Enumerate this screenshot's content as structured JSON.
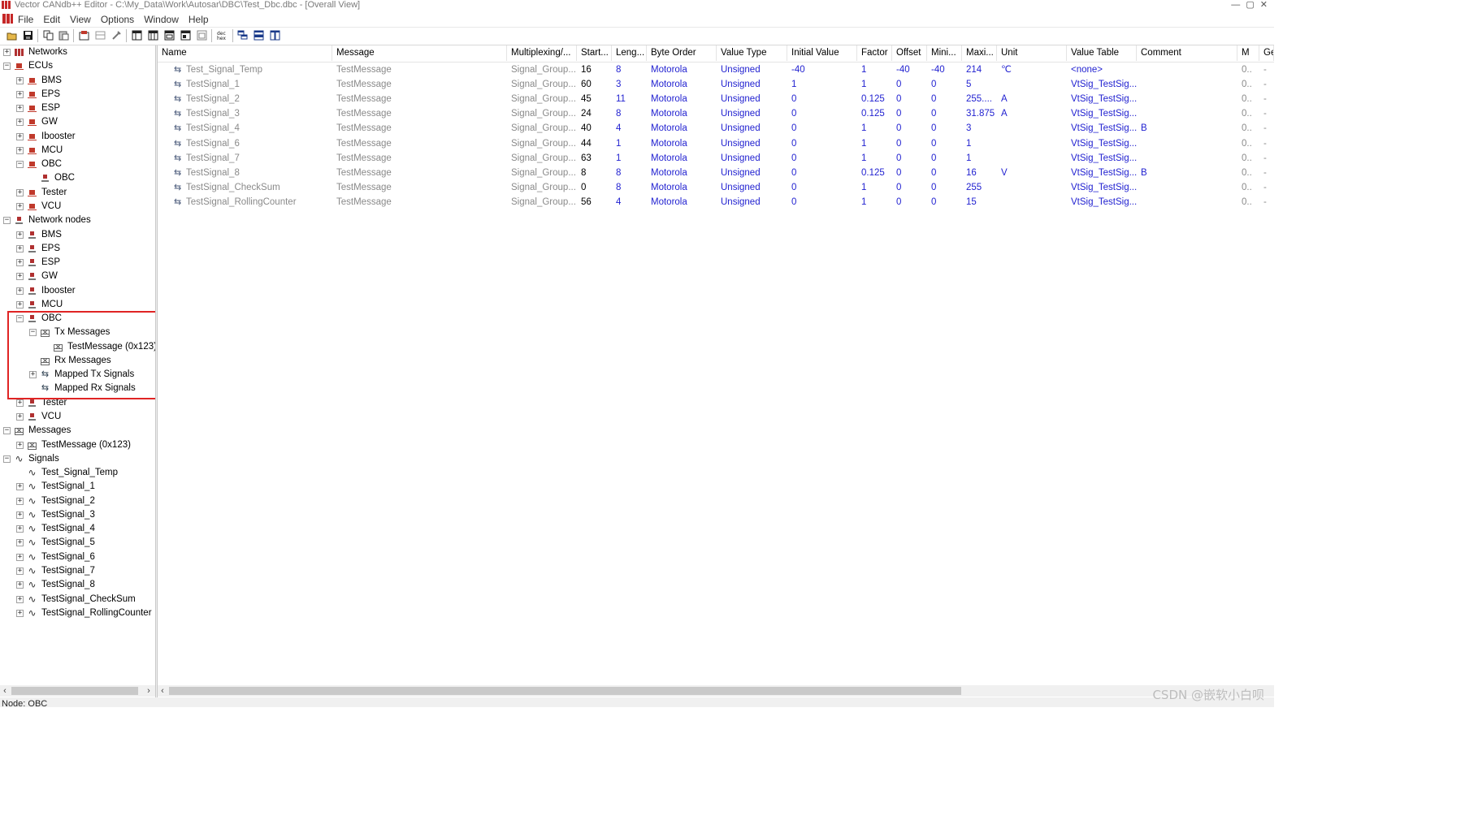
{
  "window": {
    "title": "Vector CANdb++ Editor - C:\\My_Data\\Work\\Autosar\\DBC\\Test_Dbc.dbc - [Overall View]",
    "controls": "— ▢ ✕"
  },
  "menu": [
    "File",
    "Edit",
    "View",
    "Options",
    "Window",
    "Help"
  ],
  "toolbar": {
    "buttons": [
      "open-icon",
      "save-icon",
      "copy-icon",
      "paste-icon",
      "properties-icon",
      "grid-icon",
      "tools-icon",
      "view1-icon",
      "view2-icon",
      "view3-icon",
      "view4-icon",
      "view5-icon",
      "dec-hex-icon",
      "cascade-icon",
      "tile-horizontal-icon",
      "tile-vertical-icon"
    ]
  },
  "tree": [
    {
      "label": "Networks",
      "exp": "+",
      "icon": "net"
    },
    {
      "label": "ECUs",
      "exp": "-",
      "icon": "ecu"
    },
    {
      "label": "BMS",
      "exp": "+",
      "icon": "ecu"
    },
    {
      "label": "EPS",
      "exp": "+",
      "icon": "ecu"
    },
    {
      "label": "ESP",
      "exp": "+",
      "icon": "ecu"
    },
    {
      "label": "GW",
      "exp": "+",
      "icon": "ecu"
    },
    {
      "label": "Ibooster",
      "exp": "+",
      "icon": "ecu"
    },
    {
      "label": "MCU",
      "exp": "+",
      "icon": "ecu"
    },
    {
      "label": "OBC",
      "exp": "-",
      "icon": "ecu"
    },
    {
      "label": "OBC",
      "exp": "",
      "icon": "node"
    },
    {
      "label": "Tester",
      "exp": "+",
      "icon": "ecu"
    },
    {
      "label": "VCU",
      "exp": "+",
      "icon": "ecu"
    },
    {
      "label": "Network nodes",
      "exp": "-",
      "icon": "node"
    },
    {
      "label": "BMS",
      "exp": "+",
      "icon": "node"
    },
    {
      "label": "EPS",
      "exp": "+",
      "icon": "node"
    },
    {
      "label": "ESP",
      "exp": "+",
      "icon": "node"
    },
    {
      "label": "GW",
      "exp": "+",
      "icon": "node"
    },
    {
      "label": "Ibooster",
      "exp": "+",
      "icon": "node"
    },
    {
      "label": "MCU",
      "exp": "+",
      "icon": "node"
    },
    {
      "label": "OBC",
      "exp": "-",
      "icon": "node"
    },
    {
      "label": "Tx Messages",
      "exp": "-",
      "icon": "msg"
    },
    {
      "label": "TestMessage (0x123)",
      "exp": "",
      "icon": "msg"
    },
    {
      "label": "Rx Messages",
      "exp": "",
      "icon": "msg"
    },
    {
      "label": "Mapped Tx Signals",
      "exp": "+",
      "icon": "map"
    },
    {
      "label": "Mapped Rx Signals",
      "exp": "",
      "icon": "map"
    },
    {
      "label": "Tester",
      "exp": "+",
      "icon": "node"
    },
    {
      "label": "VCU",
      "exp": "+",
      "icon": "node"
    },
    {
      "label": "Messages",
      "exp": "-",
      "icon": "msg"
    },
    {
      "label": "TestMessage (0x123)",
      "exp": "+",
      "icon": "msg"
    },
    {
      "label": "Signals",
      "exp": "-",
      "icon": "sig"
    },
    {
      "label": "Test_Signal_Temp",
      "exp": "",
      "icon": "sig"
    },
    {
      "label": "TestSignal_1",
      "exp": "+",
      "icon": "sig"
    },
    {
      "label": "TestSignal_2",
      "exp": "+",
      "icon": "sig"
    },
    {
      "label": "TestSignal_3",
      "exp": "+",
      "icon": "sig"
    },
    {
      "label": "TestSignal_4",
      "exp": "+",
      "icon": "sig"
    },
    {
      "label": "TestSignal_5",
      "exp": "+",
      "icon": "sig"
    },
    {
      "label": "TestSignal_6",
      "exp": "+",
      "icon": "sig"
    },
    {
      "label": "TestSignal_7",
      "exp": "+",
      "icon": "sig"
    },
    {
      "label": "TestSignal_8",
      "exp": "+",
      "icon": "sig"
    },
    {
      "label": "TestSignal_CheckSum",
      "exp": "+",
      "icon": "sig"
    },
    {
      "label": "TestSignal_RollingCounter",
      "exp": "+",
      "icon": "sig"
    }
  ],
  "columns": [
    "Name",
    "Message",
    "Multiplexing/...",
    "Start...",
    "Leng...",
    "Byte Order",
    "Value Type",
    "Initial Value",
    "Factor",
    "Offset",
    "Mini...",
    "Maxi...",
    "Unit",
    "Value Table",
    "Comment",
    "M",
    "Ge"
  ],
  "rows": [
    [
      "Test_Signal_Temp",
      "TestMessage",
      "Signal_Group...",
      "16",
      "8",
      "Motorola",
      "Unsigned",
      "-40",
      "1",
      "-40",
      "-40",
      "214",
      "℃",
      "<none>",
      "",
      "0..",
      "-"
    ],
    [
      "TestSignal_1",
      "TestMessage",
      "Signal_Group...",
      "60",
      "3",
      "Motorola",
      "Unsigned",
      "1",
      "1",
      "0",
      "0",
      "5",
      "",
      "VtSig_TestSig...",
      "",
      "0..",
      "-"
    ],
    [
      "TestSignal_2",
      "TestMessage",
      "Signal_Group...",
      "45",
      "11",
      "Motorola",
      "Unsigned",
      "0",
      "0.125",
      "0",
      "0",
      "255....",
      "A",
      "VtSig_TestSig...",
      "",
      "0..",
      "-"
    ],
    [
      "TestSignal_3",
      "TestMessage",
      "Signal_Group...",
      "24",
      "8",
      "Motorola",
      "Unsigned",
      "0",
      "0.125",
      "0",
      "0",
      "31.875",
      "A",
      "VtSig_TestSig...",
      "",
      "0..",
      "-"
    ],
    [
      "TestSignal_4",
      "TestMessage",
      "Signal_Group...",
      "40",
      "4",
      "Motorola",
      "Unsigned",
      "0",
      "1",
      "0",
      "0",
      "3",
      "",
      "VtSig_TestSig...",
      "B",
      "0..",
      "-"
    ],
    [
      "TestSignal_6",
      "TestMessage",
      "Signal_Group...",
      "44",
      "1",
      "Motorola",
      "Unsigned",
      "0",
      "1",
      "0",
      "0",
      "1",
      "",
      "VtSig_TestSig...",
      "",
      "0..",
      "-"
    ],
    [
      "TestSignal_7",
      "TestMessage",
      "Signal_Group...",
      "63",
      "1",
      "Motorola",
      "Unsigned",
      "0",
      "1",
      "0",
      "0",
      "1",
      "",
      "VtSig_TestSig...",
      "",
      "0..",
      "-"
    ],
    [
      "TestSignal_8",
      "TestMessage",
      "Signal_Group...",
      "8",
      "8",
      "Motorola",
      "Unsigned",
      "0",
      "0.125",
      "0",
      "0",
      "16",
      "V",
      "VtSig_TestSig...",
      "B",
      "0..",
      "-"
    ],
    [
      "TestSignal_CheckSum",
      "TestMessage",
      "Signal_Group...",
      "0",
      "8",
      "Motorola",
      "Unsigned",
      "0",
      "1",
      "0",
      "0",
      "255",
      "",
      "VtSig_TestSig...",
      "",
      "0..",
      "-"
    ],
    [
      "TestSignal_RollingCounter",
      "TestMessage",
      "Signal_Group...",
      "56",
      "4",
      "Motorola",
      "Unsigned",
      "0",
      "1",
      "0",
      "0",
      "15",
      "",
      "VtSig_TestSig...",
      "",
      "0..",
      "-"
    ]
  ],
  "colors": {
    "gray_text": "#8a8a8a",
    "blue_text": "#1f1fd0",
    "highlight": "#e02424"
  },
  "status": {
    "text": "Node: OBC"
  },
  "watermark": "CSDN @嵌软小白呗"
}
